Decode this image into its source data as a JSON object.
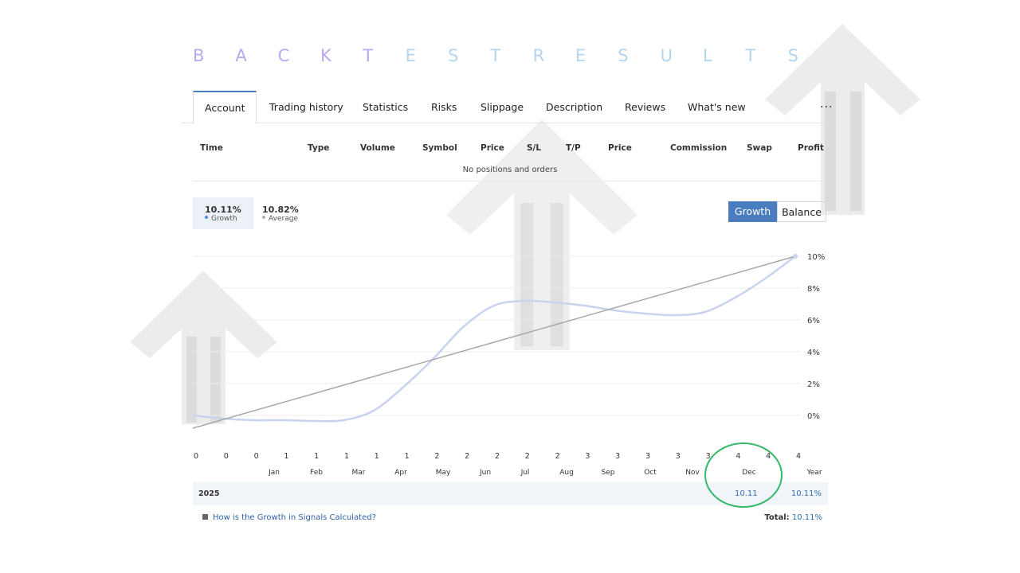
{
  "title_letters": [
    "B",
    "A",
    "C",
    "K",
    "T",
    "E",
    "S",
    "T",
    "R",
    "E",
    "S",
    "U",
    "L",
    "T",
    "S"
  ],
  "tabs": [
    "Account",
    "Trading history",
    "Statistics",
    "Risks",
    "Slippage",
    "Description",
    "Reviews",
    "What's new",
    "..."
  ],
  "table": {
    "headers": [
      "Time",
      "Type",
      "Volume",
      "Symbol",
      "Price",
      "S/L",
      "T/P",
      "Price",
      "Commission",
      "Swap",
      "Profit"
    ],
    "empty_text": "No positions and orders"
  },
  "stats": {
    "growth_value": "10.11%",
    "growth_label": "Growth",
    "average_value": "10.82%",
    "average_label": "Average"
  },
  "toggle": {
    "growth": "Growth",
    "balance": "Balance"
  },
  "colors": {
    "accent": "#4a7cc0",
    "growth_line": "#c8d3ee",
    "average_line": "#a9a9a9",
    "highlight_circle": "#34b86a"
  },
  "chart_data": {
    "type": "line",
    "ylim": [
      -2,
      10
    ],
    "y_ticks": [
      "10%",
      "8%",
      "6%",
      "4%",
      "2%",
      "0%"
    ],
    "x_trade_counts": [
      "0",
      "0",
      "0",
      "1",
      "1",
      "1",
      "1",
      "1",
      "2",
      "2",
      "2",
      "2",
      "2",
      "3",
      "3",
      "3",
      "3",
      "3",
      "4",
      "4",
      "4"
    ],
    "months": [
      "Jan",
      "Feb",
      "Mar",
      "Apr",
      "May",
      "Jun",
      "Jul",
      "Aug",
      "Sep",
      "Oct",
      "Nov",
      "Dec",
      "Year"
    ],
    "series": [
      {
        "name": "Growth",
        "x": [
          0,
          1,
          2,
          3,
          4,
          5,
          6,
          7,
          8,
          9,
          10,
          11,
          12,
          13,
          14,
          15,
          16,
          17,
          18,
          19,
          20
        ],
        "values": [
          0.0,
          -0.2,
          -0.3,
          -0.3,
          -0.35,
          -0.3,
          0.3,
          1.8,
          3.6,
          5.6,
          6.9,
          7.2,
          7.1,
          6.9,
          6.6,
          6.4,
          6.3,
          6.5,
          7.4,
          8.6,
          10.0
        ]
      },
      {
        "name": "Average",
        "x": [
          0,
          20
        ],
        "values": [
          -0.8,
          10.0
        ]
      }
    ]
  },
  "year_row": {
    "year": "2025",
    "dec_value": "10.11",
    "year_total": "10.11%"
  },
  "footer": {
    "help_link": "How is the Growth in Signals Calculated?",
    "total_label": "Total:",
    "total_value": "10.11%"
  }
}
